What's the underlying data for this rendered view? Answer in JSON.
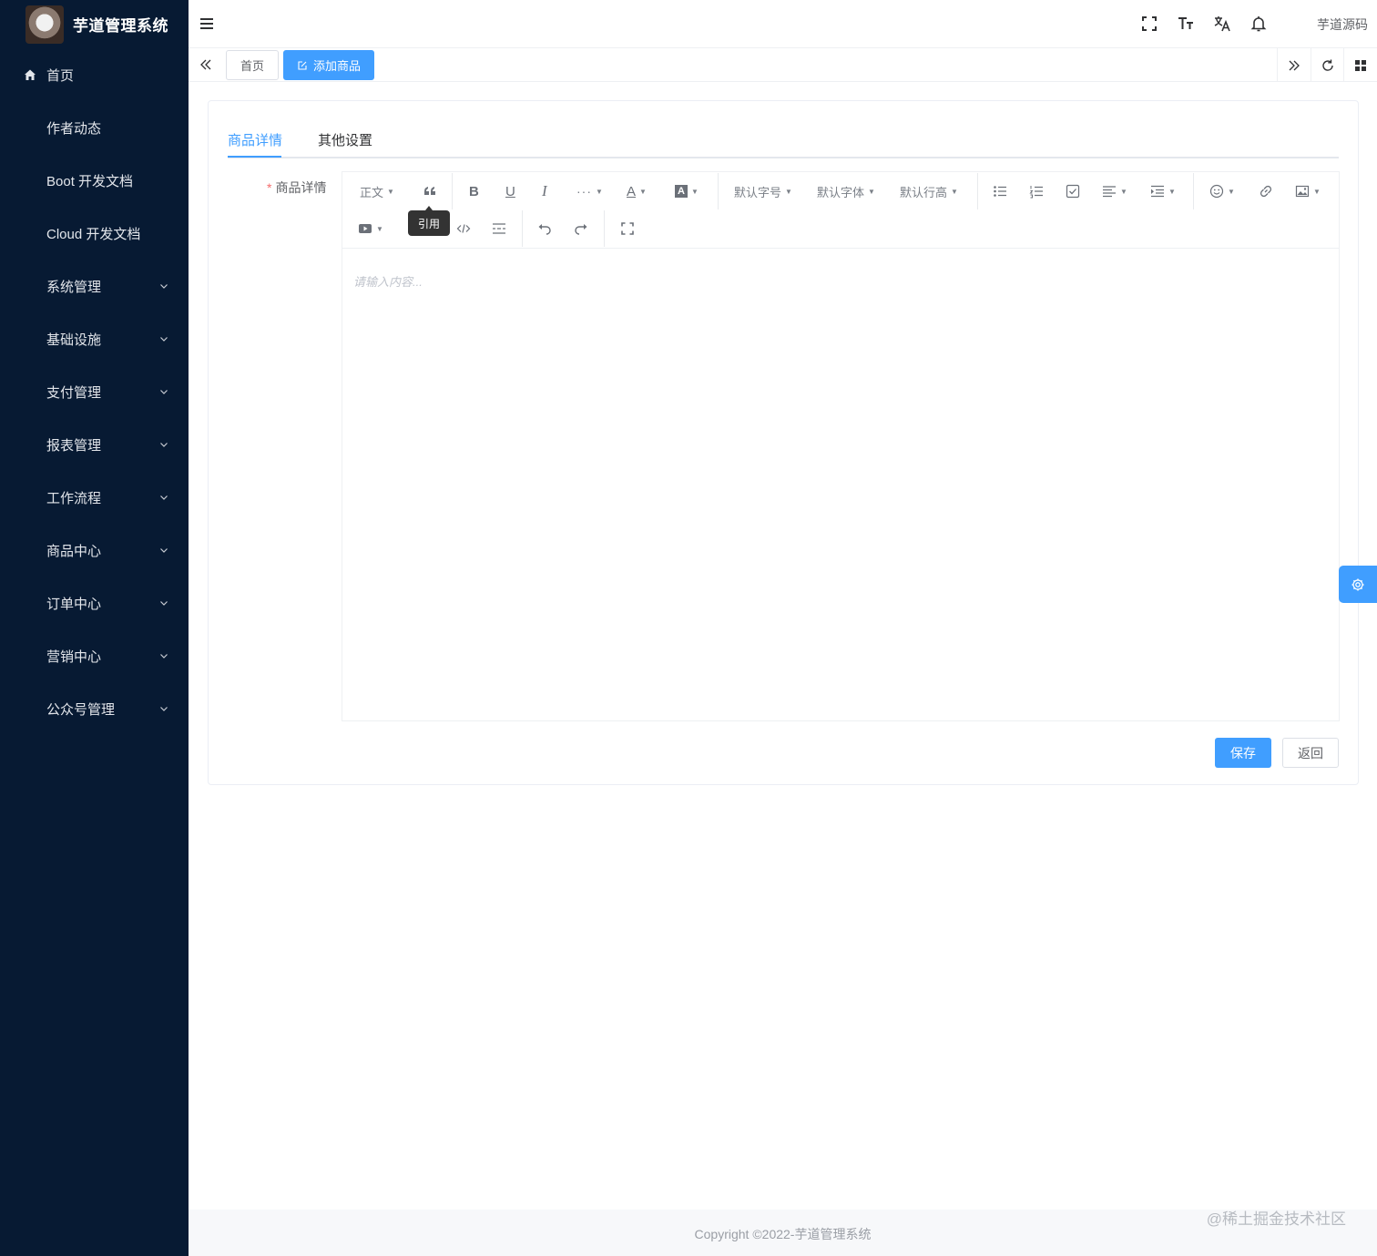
{
  "app": {
    "title": "芋道管理系统"
  },
  "sidebar": {
    "items": [
      {
        "label": "首页"
      },
      {
        "label": "作者动态"
      },
      {
        "label": "Boot 开发文档"
      },
      {
        "label": "Cloud 开发文档"
      },
      {
        "label": "系统管理"
      },
      {
        "label": "基础设施"
      },
      {
        "label": "支付管理"
      },
      {
        "label": "报表管理"
      },
      {
        "label": "工作流程"
      },
      {
        "label": "商品中心"
      },
      {
        "label": "订单中心"
      },
      {
        "label": "营销中心"
      },
      {
        "label": "公众号管理"
      }
    ]
  },
  "navbar": {
    "user": "芋道源码",
    "icons": [
      "menu-fold-icon",
      "fullscreen-icon",
      "font-size-icon",
      "translate-icon",
      "bell-icon"
    ]
  },
  "tags": {
    "home": "首页",
    "active": "添加商品"
  },
  "page": {
    "tabs": [
      {
        "label": "商品详情"
      },
      {
        "label": "其他设置"
      }
    ],
    "form_label": "商品详情",
    "required_mark": "*",
    "editor": {
      "paragraph": "正文",
      "font_size": "默认字号",
      "font_family": "默认字体",
      "line_height": "默认行高",
      "tooltip": "引用",
      "placeholder": "请输入内容..."
    },
    "save_label": "保存",
    "back_label": "返回"
  },
  "footer": {
    "copyright": "Copyright ©2022-芋道管理系统",
    "watermark": "@稀土掘金技术社区"
  },
  "colors": {
    "sidebar": "#071a33",
    "primary": "#409eff",
    "danger": "#f56c6c"
  }
}
